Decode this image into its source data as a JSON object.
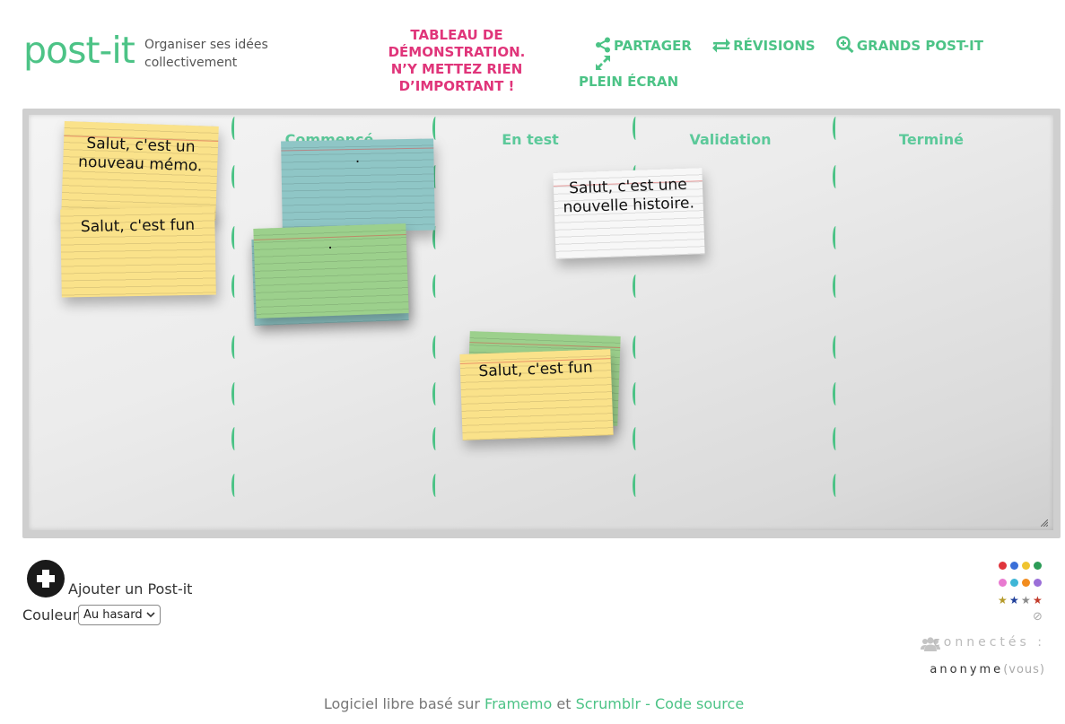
{
  "header": {
    "logo": "post-it",
    "tagline": "Organiser ses idées collectivement",
    "demo_warning": "TABLEAU DE DÉMONSTRATION. N’Y METTEZ RIEN D’IMPORTANT !",
    "nav": {
      "share": "PARTAGER",
      "revisions": "RÉVISIONS",
      "big_postits": "GRANDS POST-IT",
      "fullscreen": "PLEIN ÉCRAN"
    }
  },
  "board": {
    "columns": [
      "Commencé",
      "En test",
      "Validation",
      "Terminé"
    ],
    "notes": [
      {
        "text": "Salut, c'est un nouveau mémo.",
        "color": "yellow"
      },
      {
        "text": "Salut, c'est fun",
        "color": "yellow"
      },
      {
        "text": ".",
        "color": "blue"
      },
      {
        "text": ".",
        "color": "green"
      },
      {
        "text": "Salut, c'est une nouvelle histoire.",
        "color": "white"
      },
      {
        "text": "",
        "color": "green"
      },
      {
        "text": "Salut, c'est fun",
        "color": "yellow"
      }
    ]
  },
  "controls": {
    "add_label": "Ajouter un Post-it",
    "color_label": "Couleur",
    "color_selected": "Au hasard"
  },
  "palette": {
    "dots": [
      "#e0353c",
      "#3a6fd8",
      "#f0c430",
      "#2c9c57",
      "#e87ad0",
      "#3fb6d6",
      "#f28c1e",
      "#9b6fd8"
    ],
    "stars": [
      "#b59a2a",
      "#1f3f9a",
      "#8a8a8a",
      "#c23a2a"
    ]
  },
  "connected": {
    "label": "connectés :",
    "user": "anonyme",
    "you": "(vous)"
  },
  "footer": {
    "prefix": "Logiciel libre basé sur",
    "link1": "Framemo",
    "middle": "et",
    "link2": "Scrumblr - Code source"
  },
  "colors": {
    "accent": "#4cc386",
    "warning": "#e0357a"
  }
}
